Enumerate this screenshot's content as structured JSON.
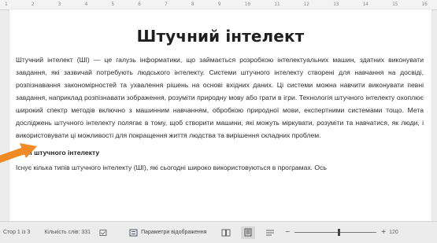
{
  "ruler": {
    "ticks": [
      "1",
      "2",
      "3",
      "4",
      "5",
      "6",
      "7",
      "8",
      "9",
      "10",
      "11",
      "12",
      "13",
      "14",
      "15",
      "16"
    ]
  },
  "document": {
    "title": "Штучний інтелект",
    "paragraph1": "Штучний інтелект (ШІ) — це галузь інформатики, що займається розробкою інтелектуальних машин, здатних виконувати завдання, які зазвичай потребують людського інтелекту. Системи штучного інтелекту створені для навчання на досвіді, розпізнавання закономірностей та ухвалення рішень на основі вхідних даних. Ці системи можна навчити виконувати певні завдання, наприклад розпізнавати зображення, розуміти природну мову або грати в ігри. Технологія штучного інтелекту охоплює широкий спектр методів включно з машинним навчанням, обробкою природної мови, експертними системами тощо. Мета досліджень штучного інтелекту полягає в тому, щоб створити машини, які можуть міркувати, розуміти та навчатися, як люди, і використовувати ці можливості для покращення життя людства та вирішення складних проблем.",
    "subheading": "Типи штучного інтелекту",
    "paragraph2": "Існує кілька типів штучного інтелекту (ШІ), які сьогодні широко використовуються в програмах. Ось"
  },
  "statusbar": {
    "page": "Стор 1 із 3",
    "words": "Кількість слів: 331",
    "display_settings": "Параметри відображення",
    "zoom_value": 0.54,
    "zoom_label": "120"
  },
  "colors": {
    "pointer": "#f08a24",
    "page_bg": "#ffffff",
    "chrome_bg": "#ececec"
  }
}
